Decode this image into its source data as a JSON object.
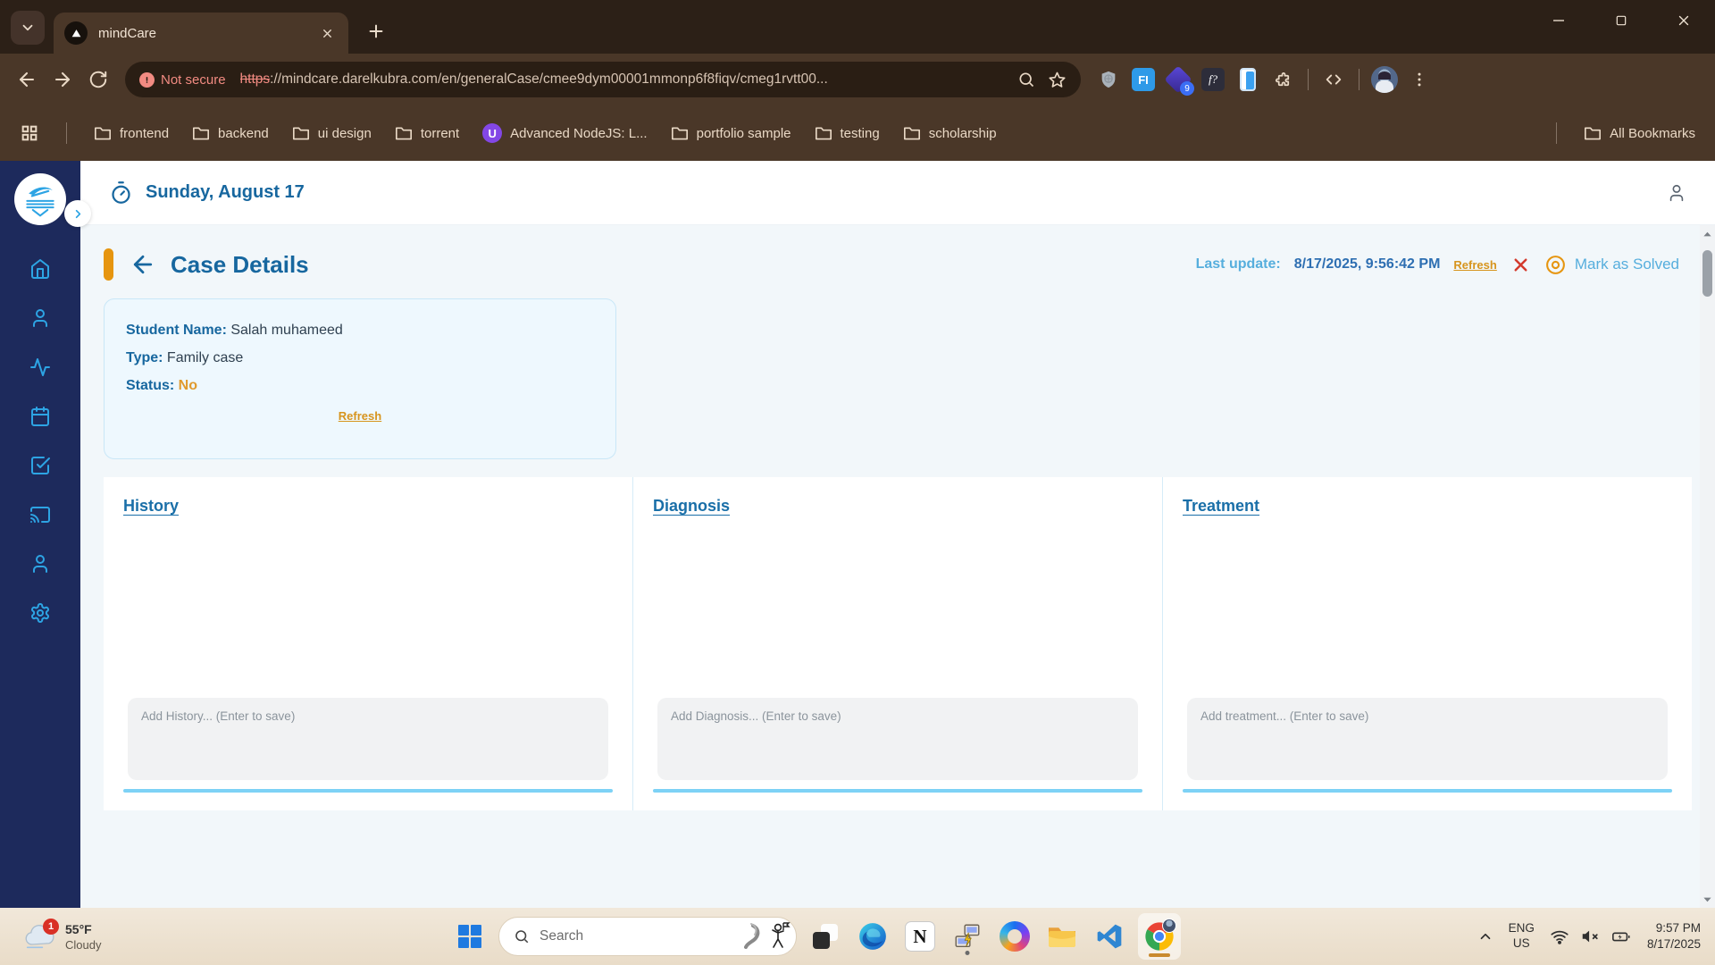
{
  "browser": {
    "tab_title": "mindCare",
    "security_label": "Not secure",
    "url_scheme": "https",
    "url_rest": "://mindcare.darelkubra.com/en/generalCase/cmee9dym00001mmonp6f8fiqv/cmeg1rvtt00...",
    "bookmarks": [
      {
        "label": "frontend",
        "icon": "folder"
      },
      {
        "label": "backend",
        "icon": "folder"
      },
      {
        "label": "ui design",
        "icon": "folder"
      },
      {
        "label": "torrent",
        "icon": "folder"
      },
      {
        "label": "Advanced NodeJS: L...",
        "icon": "udemy"
      },
      {
        "label": "portfolio sample",
        "icon": "folder"
      },
      {
        "label": "testing",
        "icon": "folder"
      },
      {
        "label": "scholarship",
        "icon": "folder"
      }
    ],
    "all_bookmarks_label": "All Bookmarks",
    "extension_badge": "9"
  },
  "glyphs": {
    "udemy": "U",
    "fi_extension": "FI",
    "fq_extension": "f?",
    "notion": "N"
  },
  "app": {
    "date": "Sunday, August 17",
    "case_title": "Case Details",
    "last_update_label": "Last update:",
    "last_update_value": "8/17/2025, 9:56:42 PM",
    "refresh_label": "Refresh",
    "mark_solved_label": "Mark as Solved",
    "info": {
      "student_label": "Student Name:",
      "student_value": " Salah muhameed",
      "type_label": "Type:",
      "type_value": " Family case",
      "status_label": "Status:",
      "status_value": " No",
      "refresh_label": "Refresh"
    },
    "columns": [
      {
        "title": "History",
        "placeholder": "Add History... (Enter to save)"
      },
      {
        "title": "Diagnosis",
        "placeholder": "Add Diagnosis... (Enter to save)"
      },
      {
        "title": "Treatment",
        "placeholder": "Add treatment... (Enter to save)"
      }
    ]
  },
  "taskbar": {
    "weather": {
      "badge": "1",
      "temp": "55°F",
      "condition": "Cloudy"
    },
    "search_placeholder": "Search",
    "lang": {
      "line1": "ENG",
      "line2": "US"
    },
    "clock": {
      "time": "9:57 PM",
      "date": "8/17/2025"
    }
  },
  "colors": {
    "accent_orange": "#e6950f",
    "primary_blue": "#17679f",
    "light_blue": "#56aedd",
    "sidebar_navy": "#1d2a5c",
    "sidebar_icon_blue": "#2da4e4",
    "status_red": "#d33a2c",
    "chrome_frame": "#4a3728",
    "card_bg": "#eef8fe"
  }
}
